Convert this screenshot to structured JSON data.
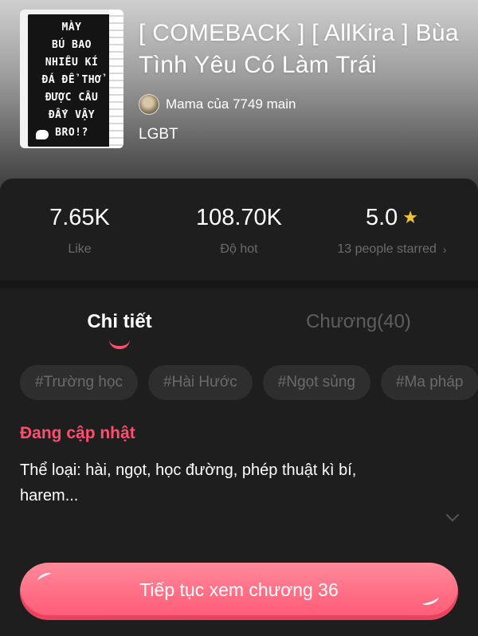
{
  "cover": {
    "text": "MÀY\nBÚ BAO\nNHIÊU KÍ\nĐÁ ĐỂ THỞ\nĐƯỢC CÂU\nĐẤY VẬY\nBRO!?"
  },
  "header": {
    "title": "[ COMEBACK ] [ AllKira ] Bùa Tình Yêu Có Làm Trái",
    "author": "Mama của 7749 main",
    "genre": "LGBT"
  },
  "stats": {
    "likes": {
      "value": "7.65K",
      "label": "Like"
    },
    "hot": {
      "value": "108.70K",
      "label": "Độ hot"
    },
    "rating": {
      "value": "5.0",
      "label": "13 people starred",
      "star_color": "#f5c431"
    }
  },
  "tabs": {
    "details": "Chi tiết",
    "chapters": "Chương(40)"
  },
  "tags": [
    "#Trường học",
    "#Hài Hước",
    "#Ngọt sủng",
    "#Ma pháp"
  ],
  "status": "Đang cập nhật",
  "description": "Thể loại: hài, ngọt, học đường, phép thuật kì bí, harem...",
  "cta": {
    "label": "Tiếp tục xem chương 36"
  },
  "colors": {
    "accent": "#ff4d6d",
    "panel": "#1e1e1e",
    "button": "#ff6e84"
  },
  "icons": {
    "star": "star-icon",
    "chevron": "chevron-right-icon",
    "expand": "chevron-down-icon"
  }
}
